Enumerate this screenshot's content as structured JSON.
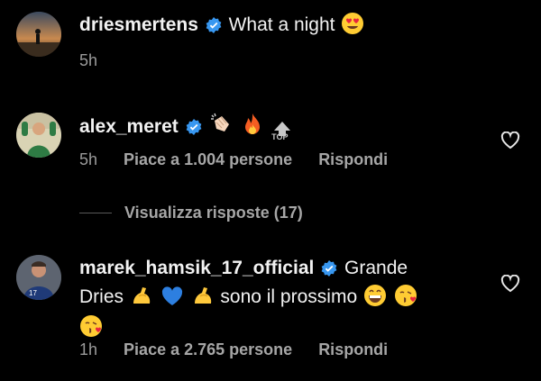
{
  "comments": [
    {
      "username": "driesmertens",
      "text": "What a night",
      "emoji": [
        "heart-eyes"
      ],
      "time": "5h"
    },
    {
      "username": "alex_meret",
      "text": "",
      "emoji": [
        "clapping-hands",
        "fire",
        "top-arrow"
      ],
      "top_label": "TOP",
      "time": "5h",
      "likes": "Piace a 1.004 persone",
      "reply_label": "Rispondi"
    },
    {
      "username": "marek_hamsik_17_official",
      "text_line1": "Grande",
      "text_line2_a": "Dries",
      "text_line2_b": "sono il prossimo",
      "emoji": [
        "flexed-biceps",
        "blue-heart",
        "flexed-biceps",
        "grinning-face",
        "kissing-face",
        "kissing-face"
      ],
      "time": "1h",
      "likes": "Piace a 2.765 persone",
      "reply_label": "Rispondi"
    }
  ],
  "view_replies": "Visualizza risposte (17)",
  "colors": {
    "background": "#000000",
    "verified": "#3897f0",
    "secondary_text": "#9a9a9a"
  }
}
